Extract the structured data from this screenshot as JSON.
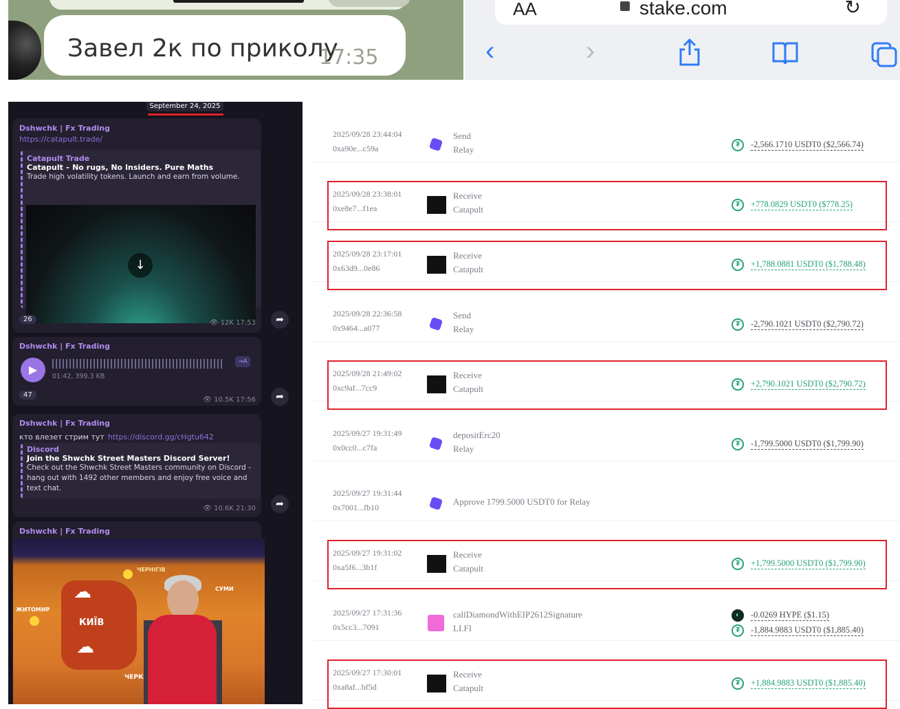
{
  "top_left": {
    "chat_message": "Завел 2к по приколу",
    "chat_time": "17:35"
  },
  "top_right": {
    "aa_label": "AA",
    "url": "stake.com",
    "icons": [
      "back-icon",
      "forward-icon",
      "share-icon",
      "bookmarks-icon",
      "tabs-icon",
      "reload-icon"
    ]
  },
  "telegram": {
    "date_header": "September 24, 2025",
    "messages": [
      {
        "author": "Dshwchk | Fx Trading",
        "link": "https://catapult.trade/",
        "preview_title": "Catapult Trade",
        "preview_headline": "Catapult – No rugs, No Insiders. Pure Maths",
        "preview_body": "Trade high volatility tokens. Launch and earn from volume.",
        "reactions": "26",
        "views": "12K",
        "time": "17:53"
      },
      {
        "author": "Dshwchk | Fx Trading",
        "voice_meta": "01:42, 399.3 KB",
        "transcribe": "→A",
        "reactions": "47",
        "views": "10.5K",
        "time": "17:56"
      },
      {
        "author": "Dshwchk | Fx Trading",
        "text": "кто влезет стрим тут",
        "link": "https://discord.gg/cHgtu642",
        "preview_title": "Discord",
        "preview_headline": "Join the Shwchk Street Masters Discord Server!",
        "preview_body": "Check out the Shwchk Street Masters community on Discord - hang out with 1492 other members and enjoy free voice and text chat.",
        "views": "10.6K",
        "time": "21:30"
      },
      {
        "author": "Dshwchk | Fx Trading",
        "map_labels": [
          "КИЇВ",
          "ЧЕРКАСИ",
          "ЖИТОМИР",
          "ЧЕРНІГІВ",
          "СУМИ"
        ]
      }
    ]
  },
  "transactions": [
    {
      "date": "2025/09/28 23:44:04",
      "hash": "0xa90e...c59a",
      "action": "Send",
      "protocol": "Relay",
      "icon": "relay",
      "amounts": [
        {
          "text": "-2,566.1710 USDT0 ($2,566.74)",
          "sign": "neg",
          "token": "usdt"
        }
      ],
      "highlighted": false
    },
    {
      "date": "2025/09/28 23:38:01",
      "hash": "0xe8e7...f1ea",
      "action": "Receive",
      "protocol": "Catapult",
      "icon": "catapult",
      "amounts": [
        {
          "text": "+778.0829 USDT0 ($778.25)",
          "sign": "pos",
          "token": "usdt"
        }
      ],
      "highlighted": true
    },
    {
      "date": "2025/09/28 23:17:01",
      "hash": "0x63d9...0e86",
      "action": "Receive",
      "protocol": "Catapult",
      "icon": "catapult",
      "amounts": [
        {
          "text": "+1,788.0881 USDT0 ($1,788.48)",
          "sign": "pos",
          "token": "usdt"
        }
      ],
      "highlighted": true
    },
    {
      "date": "2025/09/28 22:36:58",
      "hash": "0x9464...a077",
      "action": "Send",
      "protocol": "Relay",
      "icon": "relay",
      "amounts": [
        {
          "text": "-2,790.1021 USDT0 ($2,790.72)",
          "sign": "neg",
          "token": "usdt"
        }
      ],
      "highlighted": false
    },
    {
      "date": "2025/09/28 21:49:02",
      "hash": "0xc9af...7cc9",
      "action": "Receive",
      "protocol": "Catapult",
      "icon": "catapult",
      "amounts": [
        {
          "text": "+2,790.1021 USDT0 ($2,790.72)",
          "sign": "pos",
          "token": "usdt"
        }
      ],
      "highlighted": true
    },
    {
      "date": "2025/09/27 19:31:49",
      "hash": "0x0cc0...c7fa",
      "action": "depositErc20",
      "protocol": "Relay",
      "icon": "relay",
      "amounts": [
        {
          "text": "-1,799.5000 USDT0 ($1,799.90)",
          "sign": "neg",
          "token": "usdt"
        }
      ],
      "highlighted": false
    },
    {
      "date": "2025/09/27 19:31:44",
      "hash": "0x7001...fb10",
      "action": "Approve 1799.5000 USDT0 for Relay",
      "protocol": "",
      "icon": "relay",
      "amounts": [],
      "highlighted": false
    },
    {
      "date": "2025/09/27 19:31:02",
      "hash": "0xa5f6...3b1f",
      "action": "Receive",
      "protocol": "Catapult",
      "icon": "catapult",
      "amounts": [
        {
          "text": "+1,799.5000 USDT0 ($1,799.90)",
          "sign": "pos",
          "token": "usdt"
        }
      ],
      "highlighted": true
    },
    {
      "date": "2025/09/27 17:31:36",
      "hash": "0x5cc3...7091",
      "action": "callDiamondWithEIP2612Signature",
      "protocol": "LI.FI",
      "icon": "lifi",
      "amounts": [
        {
          "text": "-0.0269 HYPE ($1.15)",
          "sign": "neg",
          "token": "hype"
        },
        {
          "text": "-1,884.9883 USDT0 ($1,885.40)",
          "sign": "neg",
          "token": "usdt"
        }
      ],
      "highlighted": false
    },
    {
      "date": "2025/09/27 17:30:01",
      "hash": "0xa8af...bf5d",
      "action": "Receive",
      "protocol": "Catapult",
      "icon": "catapult",
      "amounts": [
        {
          "text": "+1,884.9883 USDT0 ($1,885.40)",
          "sign": "pos",
          "token": "usdt"
        }
      ],
      "highlighted": true
    }
  ]
}
